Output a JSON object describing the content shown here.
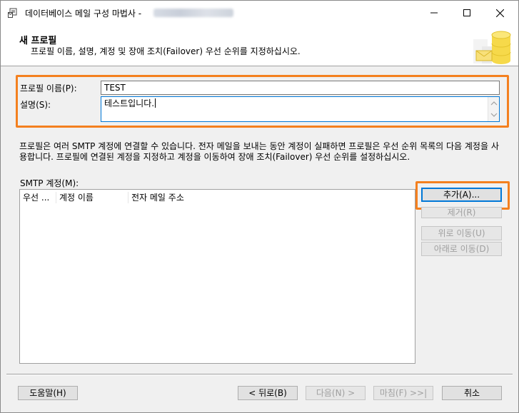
{
  "window": {
    "title": "데이터베이스 메일 구성 마법사 -"
  },
  "header": {
    "title": "새 프로필",
    "subtitle": "프로필 이름, 설명, 계정 및 장애 조치(Failover) 우선 순위를 지정하십시오."
  },
  "profile": {
    "name_label": "프로필 이름(P):",
    "name_value": "TEST",
    "desc_label": "설명(S):",
    "desc_value": "테스트입니다."
  },
  "info_text": "프로필은 여러 SMTP 계정에 연결할 수 있습니다. 전자 메일을 보내는 동안 계정이 실패하면 프로필은 우선 순위 목록의 다음 계정을 사용합니다. 프로필에 연결된 계정을 지정하고 계정을 이동하여 장애 조치(Failover) 우선 순위를 설정하십시오.",
  "smtp": {
    "label": "SMTP 계정(M):",
    "columns": [
      "우선 ...",
      "계정 이름",
      "전자 메일 주소"
    ]
  },
  "side_buttons": {
    "add": "추가(A)...",
    "remove": "제거(R)",
    "move_up": "위로 이동(U)",
    "move_down": "아래로 이동(D)"
  },
  "footer": {
    "help": "도움말(H)",
    "back": "< 뒤로(B)",
    "next": "다음(N) >",
    "finish": "마침(F) >>|",
    "cancel": "취소"
  },
  "colors": {
    "highlight": "#f4801f",
    "focus": "#0078d7"
  }
}
